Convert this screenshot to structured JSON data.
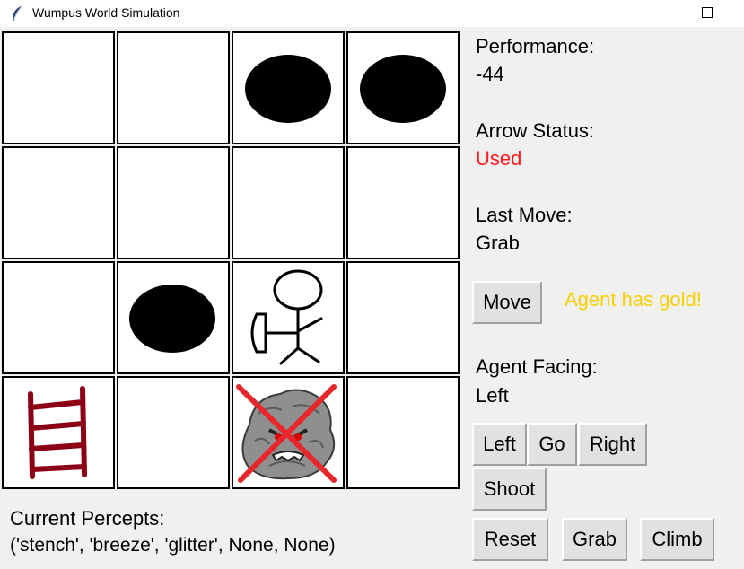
{
  "window": {
    "title": "Wumpus World Simulation",
    "icon": "feather-icon"
  },
  "colors": {
    "arrow_status": "#ff1a1a",
    "gold_message": "#f5d000",
    "ladder": "#8b0014",
    "cross": "#e8272c"
  },
  "board": {
    "rows": [
      [
        "empty",
        "empty",
        "pit",
        "pit"
      ],
      [
        "empty",
        "empty",
        "empty",
        "empty"
      ],
      [
        "empty",
        "pit",
        "agent",
        "empty"
      ],
      [
        "ladder",
        "empty",
        "dead-wumpus",
        "empty"
      ]
    ]
  },
  "performance": {
    "label": "Performance:",
    "value": "-44"
  },
  "arrow": {
    "label": "Arrow Status:",
    "value": "Used"
  },
  "last_move": {
    "label": "Last Move:",
    "value": "Grab"
  },
  "move_button": "Move",
  "status_message": "Agent has gold!",
  "facing": {
    "label": "Agent Facing:",
    "value": "Left"
  },
  "controls": {
    "left": "Left",
    "go": "Go",
    "right": "Right",
    "shoot": "Shoot",
    "reset": "Reset",
    "grab": "Grab",
    "climb": "Climb"
  },
  "percepts": {
    "label": "Current Percepts:",
    "value": "('stench', 'breeze', 'glitter', None, None)"
  }
}
